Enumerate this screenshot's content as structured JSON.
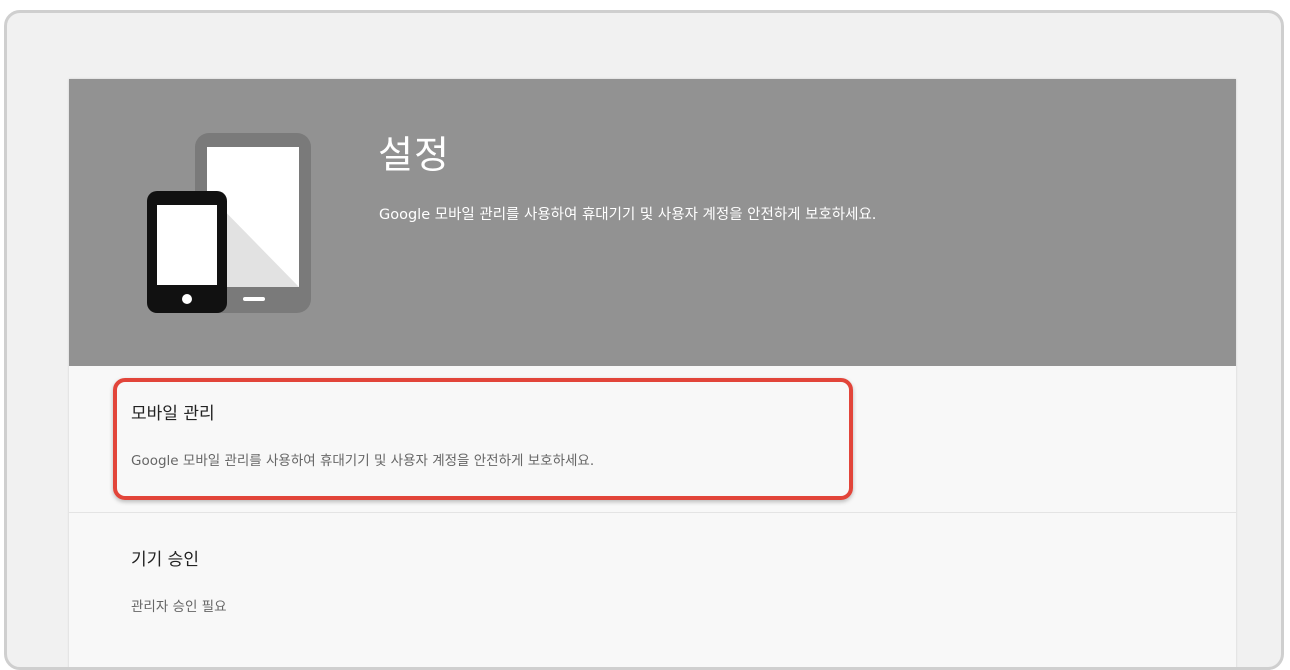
{
  "header": {
    "title": "설정",
    "subtitle": "Google 모바일 관리를 사용하여 휴대기기 및 사용자 계정을 안전하게 보호하세요.",
    "icon": "devices-icon"
  },
  "settings": {
    "items": [
      {
        "title": "모바일 관리",
        "description": "Google 모바일 관리를 사용하여 휴대기기 및 사용자 계정을 안전하게 보호하세요."
      },
      {
        "title": "기기 승인",
        "description": "관리자 승인 필요"
      }
    ]
  },
  "highlight": {
    "color": "#e2453a"
  },
  "colors": {
    "header_bg": "#929292",
    "card_bg": "#f8f8f8"
  }
}
